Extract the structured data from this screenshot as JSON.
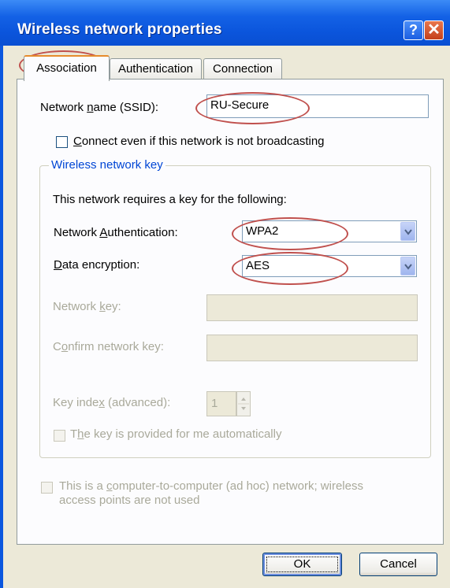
{
  "window": {
    "title": "Wireless network properties",
    "help_glyph": "?",
    "close_glyph": "✕"
  },
  "tabs": [
    {
      "label": "Association",
      "active": true
    },
    {
      "label": "Authentication",
      "active": false
    },
    {
      "label": "Connection",
      "active": false
    }
  ],
  "association": {
    "ssid_label_pre": "Network ",
    "ssid_label_key": "n",
    "ssid_label_post": "ame (SSID):",
    "ssid_value": "RU-Secure",
    "connect_label_key": "C",
    "connect_label_post": "onnect even if this network is not broadcasting",
    "connect_checked": false,
    "group_title": "Wireless network key",
    "requires_text": "This network requires a key for the following:",
    "auth_label_pre": "Network ",
    "auth_label_key": "A",
    "auth_label_post": "uthentication:",
    "auth_value": "WPA2",
    "enc_label_key": "D",
    "enc_label_post": "ata encryption:",
    "enc_value": "AES",
    "netkey_label_pre": "Network ",
    "netkey_label_key": "k",
    "netkey_label_post": "ey:",
    "netkey_value": "",
    "confirm_label_pre": "C",
    "confirm_label_key": "o",
    "confirm_label_post": "nfirm network key:",
    "confirm_value": "",
    "keyindex_label_pre": "Key inde",
    "keyindex_label_key": "x",
    "keyindex_label_post": " (advanced):",
    "keyindex_value": "1",
    "auto_label_pre": "T",
    "auto_label_key": "h",
    "auto_label_post": "e key is provided for me automatically",
    "auto_checked": false,
    "adhoc_line1_pre": "This is a ",
    "adhoc_line1_key": "c",
    "adhoc_line1_post": "omputer-to-computer (ad hoc) network; wireless",
    "adhoc_line2": "access points are not used",
    "adhoc_checked": false
  },
  "buttons": {
    "ok_label": "OK",
    "cancel_label": "Cancel"
  },
  "colors": {
    "titlebar": "#0b55dc",
    "group_title": "#0046d5",
    "highlight_ring": "#c0504d",
    "active_tab_accent": "#e68b2c"
  }
}
